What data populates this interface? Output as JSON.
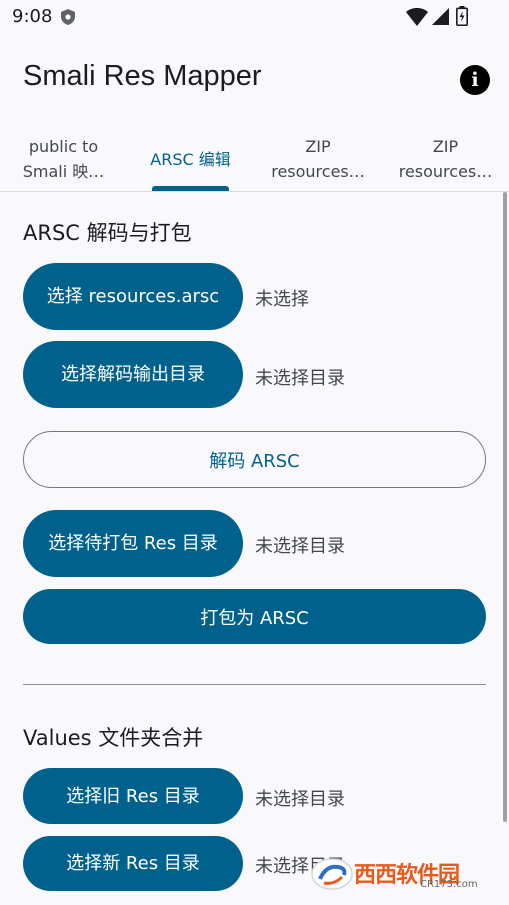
{
  "status_bar": {
    "time": "9:08"
  },
  "app_bar": {
    "title": "Smali Res Mapper"
  },
  "tabs": [
    {
      "label": "public to Smali 映…"
    },
    {
      "label": "ARSC 编辑"
    },
    {
      "label": "ZIP resources…"
    },
    {
      "label": "ZIP resources…"
    }
  ],
  "arsc_section": {
    "title": "ARSC 解码与打包",
    "select_arsc_button": "选择 resources.arsc",
    "select_arsc_status": "未选择",
    "select_decode_dir_button": "选择解码输出目录",
    "select_decode_dir_status": "未选择目录",
    "decode_button": "解码 ARSC",
    "select_pack_dir_button": "选择待打包 Res 目录",
    "select_pack_dir_status": "未选择目录",
    "pack_button": "打包为 ARSC"
  },
  "values_section": {
    "title": "Values 文件夹合并",
    "select_old_button": "选择旧 Res 目录",
    "select_old_status": "未选择目录",
    "select_new_button": "选择新 Res 目录",
    "select_new_status": "未选择目录"
  },
  "watermark": {
    "main": "西西软件园",
    "sub": "CR173.com"
  },
  "colors": {
    "primary": "#00628c",
    "background": "#f9f9fc",
    "watermark": "#e85a1a"
  }
}
